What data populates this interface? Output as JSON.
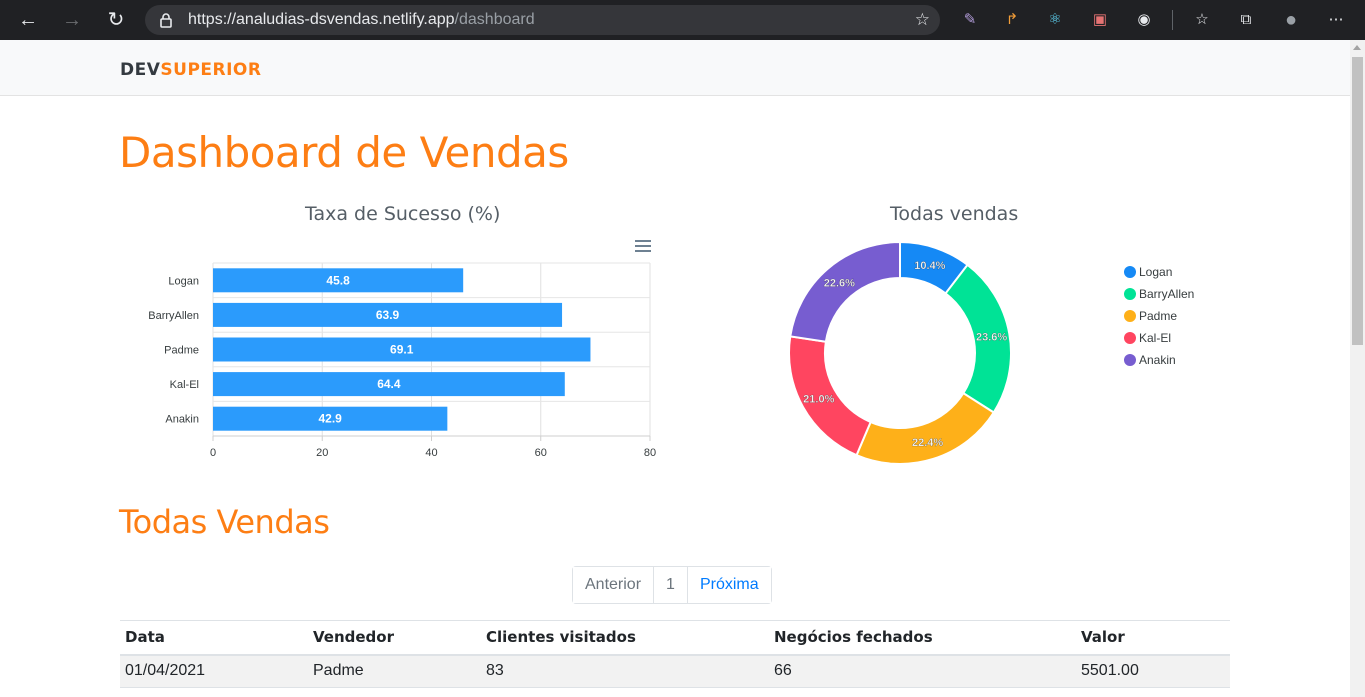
{
  "browser": {
    "url_host": "https://analudias-dsvendas.netlify.app",
    "url_path": "/dashboard"
  },
  "brand": {
    "part1": "DEV",
    "part2": "SUPERIOR"
  },
  "page_title": "Dashboard de Vendas",
  "section_title": "Todas Vendas",
  "colors": {
    "accent": "#fd7e14",
    "bar": "#2b9bfc",
    "series": [
      "#1589f5",
      "#00e396",
      "#feb019",
      "#ff4560",
      "#775dd0"
    ]
  },
  "chart_data": [
    {
      "type": "bar",
      "orientation": "horizontal",
      "title": "Taxa de Sucesso (%)",
      "categories": [
        "Logan",
        "BarryAllen",
        "Padme",
        "Kal-El",
        "Anakin"
      ],
      "values": [
        45.8,
        63.9,
        69.1,
        64.4,
        42.9
      ],
      "xlim": [
        0,
        80
      ],
      "xticks": [
        0,
        20,
        40,
        60,
        80
      ],
      "grid": true
    },
    {
      "type": "pie",
      "variant": "donut",
      "title": "Todas vendas",
      "labels": [
        "Logan",
        "BarryAllen",
        "Padme",
        "Kal-El",
        "Anakin"
      ],
      "values": [
        10.4,
        23.6,
        22.4,
        21.0,
        22.6
      ],
      "value_labels": [
        "10.4%",
        "23.6%",
        "22.4%",
        "21.0%",
        "22.6%"
      ],
      "legend": "right"
    }
  ],
  "pagination": {
    "prev": "Anterior",
    "page": "1",
    "next": "Próxima"
  },
  "table": {
    "headers": [
      "Data",
      "Vendedor",
      "Clientes visitados",
      "Negócios fechados",
      "Valor"
    ],
    "rows": [
      [
        "01/04/2021",
        "Padme",
        "83",
        "66",
        "5501.00"
      ]
    ]
  }
}
